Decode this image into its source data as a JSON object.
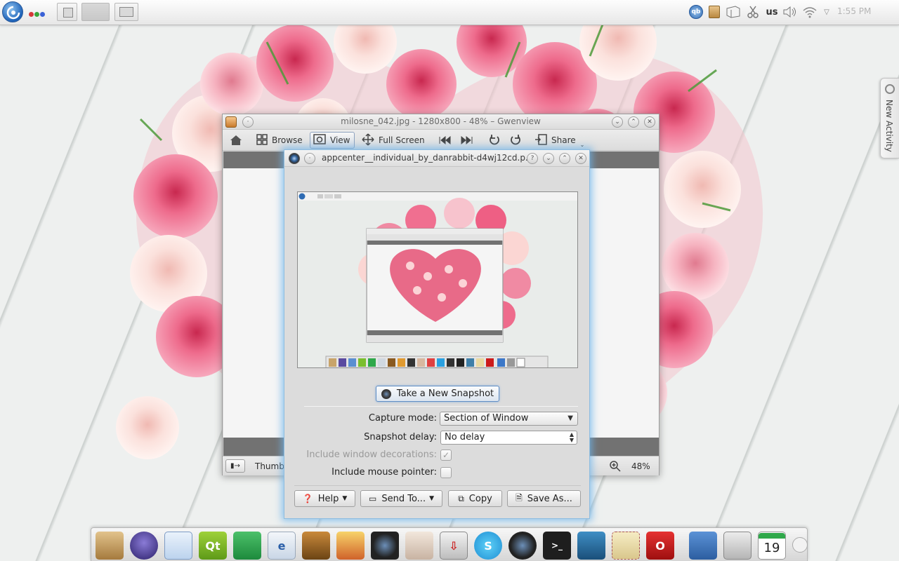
{
  "top_panel": {
    "keyboard_layout": "us",
    "clock": "1:55 PM"
  },
  "new_activity": {
    "label": "New Activity"
  },
  "gwenview": {
    "title": "milosne_042.jpg - 1280x800 - 48% – Gwenview",
    "toolbar": {
      "browse": "Browse",
      "view": "View",
      "full_screen": "Full Screen",
      "share": "Share"
    },
    "status": {
      "thumbnail_bar": "Thumbnail Bar",
      "zoom": "48%"
    }
  },
  "ksnapshot": {
    "title": "appcenter__individual_by_danrabbit-d4wj12cd.p...",
    "take_snapshot": "Take a New Snapshot",
    "capture_mode_label": "Capture mode:",
    "capture_mode_value": "Section of Window",
    "snapshot_delay_label": "Snapshot delay:",
    "snapshot_delay_value": "No delay",
    "include_decorations_label": "Include window decorations:",
    "include_pointer_label": "Include mouse pointer:",
    "buttons": {
      "help": "Help",
      "send_to": "Send To...",
      "copy": "Copy",
      "save_as": "Save As..."
    }
  },
  "dock": {
    "calendar_day": "19",
    "qt_label": "Qt"
  },
  "colors": {
    "accent": "#5f8dc4",
    "dialog_glow": "#6eb4eb",
    "rose_pink": "#e25c80"
  }
}
